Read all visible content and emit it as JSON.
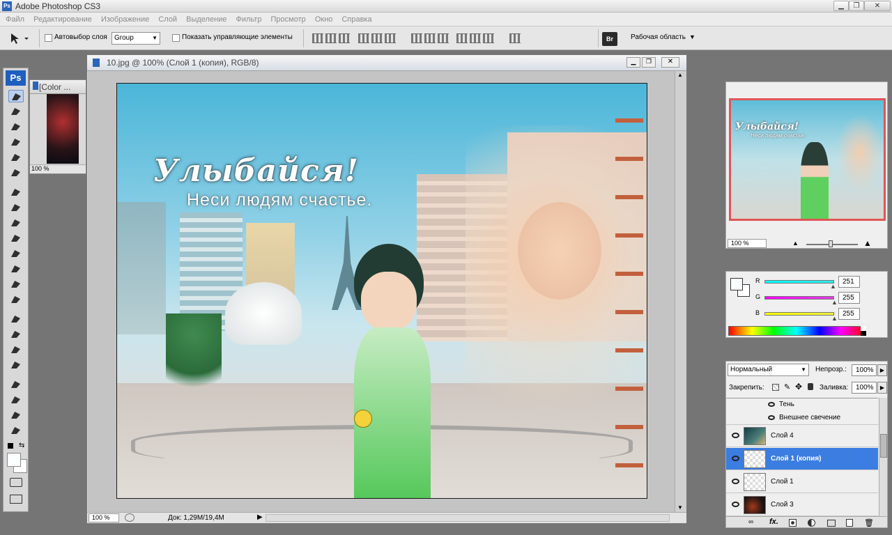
{
  "app": {
    "icon": "Ps",
    "title": "Adobe Photoshop CS3"
  },
  "window_buttons": {
    "minimize": "▁",
    "restore": "❐",
    "close": "✕"
  },
  "menu": [
    "Файл",
    "Редактирование",
    "Изображение",
    "Слой",
    "Выделение",
    "Фильтр",
    "Просмотр",
    "Окно",
    "Справка"
  ],
  "options": {
    "autoselect_label": "Автовыбор слоя",
    "autoselect_value": "Group",
    "show_controls_label": "Показать управляющие элементы",
    "workspace_label": "Рабочая область",
    "br_label": "Br"
  },
  "toolbox": {
    "logo": "Ps"
  },
  "doc2": {
    "title": "[Color ...",
    "zoom": "100 %"
  },
  "document": {
    "title": "10.jpg @ 100% (Слой 1 (копия), RGB/8)",
    "zoom": "100 %",
    "doc_info": "Док: 1,29M/19,4M"
  },
  "artwork": {
    "headline": "Улыбайся!",
    "subline": "Неси людям счастье."
  },
  "navigator": {
    "zoom": "100 %"
  },
  "color": {
    "labels": [
      "R",
      "G",
      "B"
    ],
    "values": [
      "251",
      "255",
      "255"
    ],
    "slider_colors": [
      "#30e8e8",
      "#e040e0",
      "#f0f040"
    ]
  },
  "layers": {
    "blend_mode": "Нормальный",
    "opacity_label": "Непрозр.:",
    "opacity_value": "100%",
    "lock_label": "Закрепить:",
    "fill_label": "Заливка:",
    "fill_value": "100%",
    "effects": [
      "Тень",
      "Внешнее свечение"
    ],
    "items": [
      {
        "name": "Слой 4",
        "selected": false
      },
      {
        "name": "Слой 1 (копия)",
        "selected": true
      },
      {
        "name": "Слой 1",
        "selected": false
      },
      {
        "name": "Слой 3",
        "selected": false
      }
    ],
    "footer_fx": "fx."
  }
}
